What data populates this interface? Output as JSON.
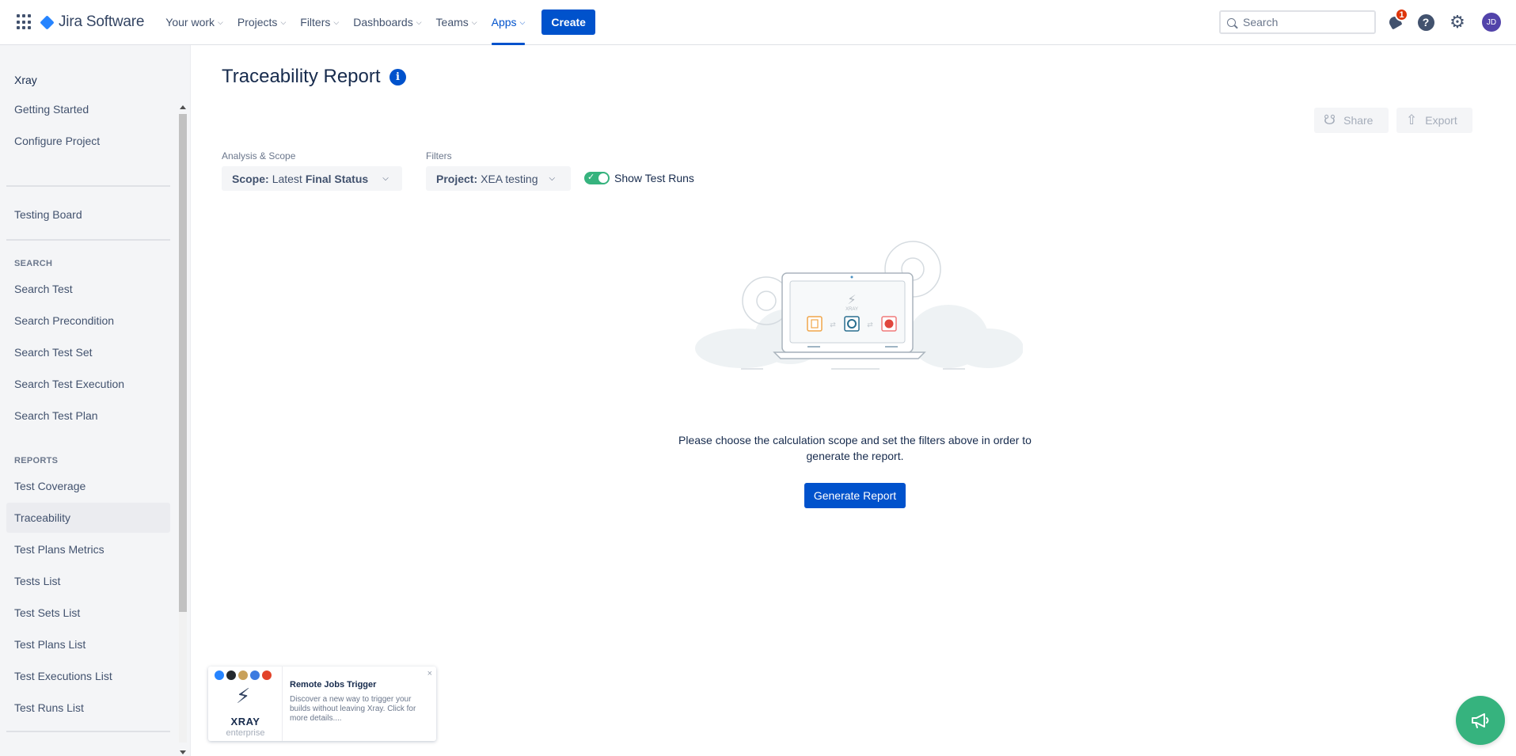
{
  "topnav": {
    "logo_text": "Jira Software",
    "items": [
      {
        "label": "Your work"
      },
      {
        "label": "Projects"
      },
      {
        "label": "Filters"
      },
      {
        "label": "Dashboards"
      },
      {
        "label": "Teams"
      },
      {
        "label": "Apps",
        "active": true
      }
    ],
    "create_label": "Create",
    "search_placeholder": "Search",
    "notification_count": "1",
    "avatar_initials": "JD",
    "accent_color": "#0052cc"
  },
  "sidebar": {
    "title": "Xray",
    "top_items": [
      "Getting Started",
      "Configure Project"
    ],
    "board_item": "Testing Board",
    "search_heading": "SEARCH",
    "search_items": [
      "Search Test",
      "Search Precondition",
      "Search Test Set",
      "Search Test Execution",
      "Search Test Plan"
    ],
    "reports_heading": "REPORTS",
    "report_items": [
      "Test Coverage",
      "Traceability",
      "Test Plans Metrics",
      "Tests List",
      "Test Sets List",
      "Test Plans List",
      "Test Executions List",
      "Test Runs List"
    ],
    "selected_item": "Traceability"
  },
  "main": {
    "title": "Traceability Report",
    "share_label": "Share",
    "export_label": "Export",
    "analysis_label": "Analysis & Scope",
    "scope_key": "Scope:",
    "scope_value_prefix": "Latest",
    "scope_value_bold": "Final Status",
    "filters_label": "Filters",
    "project_key": "Project:",
    "project_value": "XEA testing",
    "toggle_label": "Show Test Runs",
    "toggle_on": true,
    "illustration_text": "XRAY",
    "empty_message": "Please choose the calculation scope and set the filters above in order to generate the report.",
    "generate_label": "Generate Report"
  },
  "promo": {
    "brand": "XRAY",
    "brand_sub": "enterprise",
    "title": "Remote Jobs Trigger",
    "text": "Discover a new way to trigger your builds without leaving Xray. Click for more details....",
    "close": "×"
  },
  "icons": {
    "app_switcher": "grid-icon",
    "search": "search-icon",
    "notifications": "bell-icon",
    "help": "help-icon",
    "settings": "gear-icon",
    "info": "info-icon",
    "feedback": "megaphone-icon"
  }
}
